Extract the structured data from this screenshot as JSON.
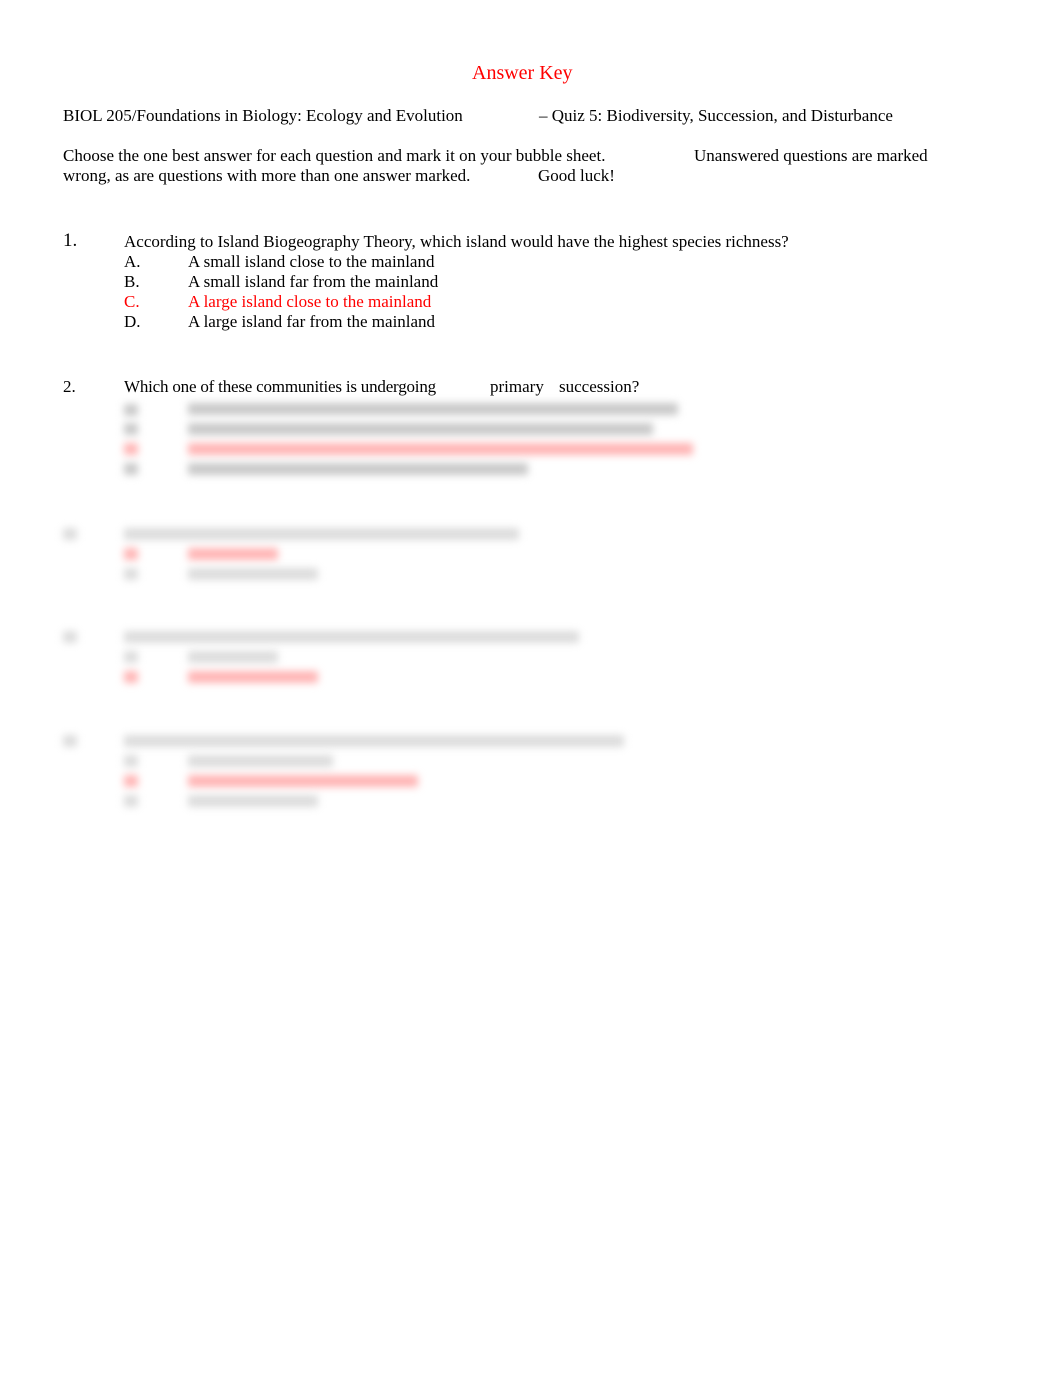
{
  "header": {
    "title": "Answer Key",
    "course": "BIOL 205/Foundations in Biology: Ecology and Evolution",
    "quiz": "– Quiz 5: Biodiversity, Succession, and Disturbance"
  },
  "instructions": {
    "line1a": "Choose the one best answer for each question and mark it on your bubble sheet.",
    "line1b": "Unanswered questions are marked",
    "line2a": "wrong, as are questions with more than one answer marked.",
    "line2b": "Good luck!"
  },
  "questions": [
    {
      "number": "1.",
      "text": "According to Island Biogeography Theory, which island would have the highest species richness?",
      "options": [
        {
          "letter": "A.",
          "text": "A small island close to the mainland",
          "correct": false
        },
        {
          "letter": "B.",
          "text": "A small island far from the mainland",
          "correct": false
        },
        {
          "letter": "C.",
          "text": "A large island close to the mainland",
          "correct": true
        },
        {
          "letter": "D.",
          "text": "A large island far from the mainland",
          "correct": false
        }
      ]
    },
    {
      "number": "2.",
      "text_a": "Which one of these communities is undergoing",
      "text_b": "primary",
      "text_c": "succession?",
      "options_obscured": true
    }
  ],
  "obscured_content": true,
  "colors": {
    "answer": "#ff0000",
    "text": "#000000"
  }
}
